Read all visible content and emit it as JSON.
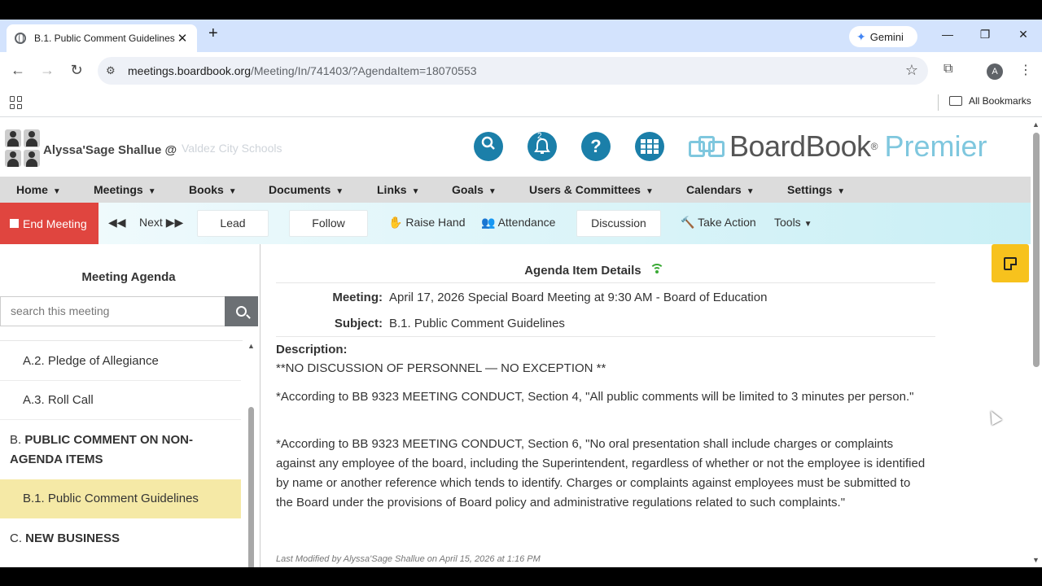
{
  "browser": {
    "tab_title": "B.1. Public Comment Guidelines",
    "tab_close": "✕",
    "new_tab": "+",
    "gemini_label": "Gemini",
    "url_host": "meetings.boardbook.org",
    "url_path": "/Meeting/In/741403/?AgendaItem=18070553",
    "profile_initial": "A",
    "all_bookmarks": "All Bookmarks",
    "window_controls": {
      "minimize": "—",
      "restore": "❐",
      "close": "✕"
    }
  },
  "header": {
    "user_name": "Alyssa'Sage Shallue @",
    "district": "Valdez City Schools",
    "notification_count": "2",
    "logo_main": "BoardBook",
    "logo_reg": "®",
    "logo_sub": "Premier"
  },
  "nav": {
    "items": [
      "Home",
      "Meetings",
      "Books",
      "Documents",
      "Links",
      "Goals",
      "Users & Committees",
      "Calendars",
      "Settings"
    ]
  },
  "toolbar": {
    "end_meeting": "End Meeting",
    "next": "Next",
    "lead": "Lead",
    "follow": "Follow",
    "raise_hand": "Raise Hand",
    "attendance": "Attendance",
    "discussion": "Discussion",
    "take_action": "Take Action",
    "tools": "Tools"
  },
  "agenda": {
    "title": "Meeting Agenda",
    "search_placeholder": "search this meeting",
    "items": [
      {
        "text": "A.2. Pledge of Allegiance"
      },
      {
        "text": "A.3. Roll Call"
      },
      {
        "prefix": "B.",
        "text": "PUBLIC COMMENT ON NON-AGENDA ITEMS"
      },
      {
        "text": "B.1. Public Comment Guidelines"
      },
      {
        "prefix": "C.",
        "text": "NEW BUSINESS"
      }
    ]
  },
  "details": {
    "title": "Agenda Item Details",
    "meeting_label": "Meeting:",
    "meeting_value": "April 17, 2026 Special Board Meeting at 9:30 AM - Board of Education",
    "subject_label": "Subject:",
    "subject_value": "B.1. Public Comment Guidelines",
    "description_label": "Description:",
    "description": [
      "**NO DISCUSSION OF PERSONNEL — NO EXCEPTION **",
      "*According to BB 9323 MEETING CONDUCT, Section 4, \"All public comments will be limited to 3 minutes per person.\"",
      "*According to BB 9323 MEETING CONDUCT, Section 6, \"No oral presentation shall include charges or complaints against any employee of the board, including the Superintendent, regardless of whether or not the employee is identified by name or another reference which tends to identify. Charges or complaints against employees must be submitted to the Board under the provisions of Board policy and administrative regulations related to such complaints.\""
    ],
    "last_modified": "Last Modified by Alyssa'Sage Shallue on April 15, 2026 at 1:16 PM"
  },
  "colors": {
    "end_meeting_bg": "#e0453f",
    "brand_teal": "#1b7fa9",
    "active_item_bg": "#f5e9a6",
    "sticky_note": "#f7c21d",
    "wifi_green": "#3aaa35"
  }
}
